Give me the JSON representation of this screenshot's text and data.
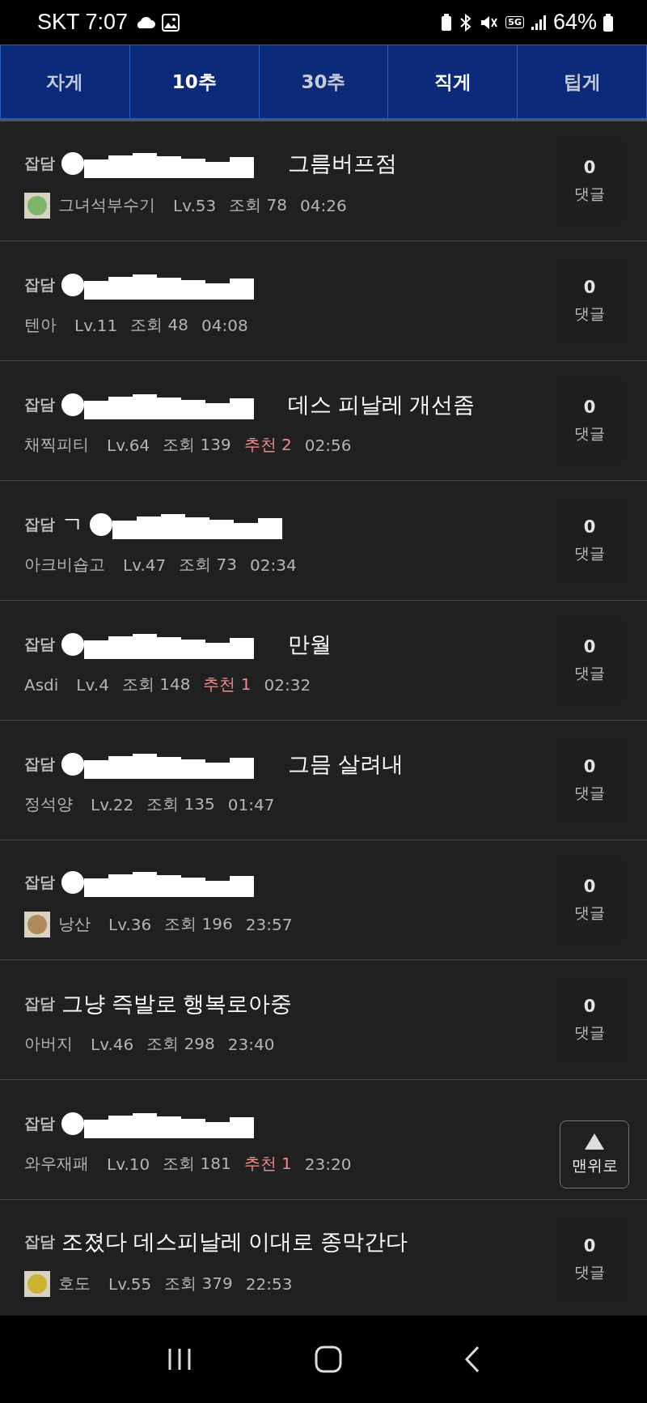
{
  "status_bar": {
    "carrier_time": "SKT 7:07",
    "network": "5G",
    "battery": "64%"
  },
  "tabs": [
    {
      "label": "자게",
      "selected": false
    },
    {
      "label": "10추",
      "selected": true
    },
    {
      "label": "30추",
      "selected": false
    },
    {
      "label": "직게",
      "selected": true
    },
    {
      "label": "팁게",
      "selected": false
    }
  ],
  "posts": [
    {
      "category": "잡담",
      "redacted": true,
      "title": "그름버프점",
      "avatar": {
        "color": "#7fb36a"
      },
      "author": "그녀석부수기",
      "level": "Lv.53",
      "views": "조회 78",
      "time": "04:26",
      "comments": "0",
      "comments_label": "댓글"
    },
    {
      "category": "잡담",
      "redacted": true,
      "author": "텐아",
      "level": "Lv.11",
      "views": "조회 48",
      "time": "04:08",
      "comments": "0",
      "comments_label": "댓글"
    },
    {
      "category": "잡담",
      "redacted": true,
      "title": "데스 피날레 개선좀",
      "author": "채찍피티",
      "level": "Lv.64",
      "views": "조회 139",
      "recommend": "추천 2",
      "time": "02:56",
      "comments": "0",
      "comments_label": "댓글"
    },
    {
      "category": "잡담",
      "prefix": "ㄱ",
      "redacted": true,
      "author": "아크비숍고",
      "level": "Lv.47",
      "views": "조회 73",
      "time": "02:34",
      "comments": "0",
      "comments_label": "댓글"
    },
    {
      "category": "잡담",
      "redacted": true,
      "title": "만월",
      "author": "Asdi",
      "level": "Lv.4",
      "views": "조회 148",
      "recommend": "추천 1",
      "time": "02:32",
      "comments": "0",
      "comments_label": "댓글"
    },
    {
      "category": "잡담",
      "redacted": true,
      "title": "그믐 살려내",
      "author": "정석양",
      "level": "Lv.22",
      "views": "조회 135",
      "time": "01:47",
      "comments": "0",
      "comments_label": "댓글"
    },
    {
      "category": "잡담",
      "redacted": true,
      "avatar": {
        "color": "#b08a5a"
      },
      "author": "낭산",
      "level": "Lv.36",
      "views": "조회 196",
      "time": "23:57",
      "comments": "0",
      "comments_label": "댓글"
    },
    {
      "category": "잡담",
      "redacted": false,
      "title": "그냥 즉발로 행복로아중",
      "author": "아버지",
      "level": "Lv.46",
      "views": "조회 298",
      "time": "23:40",
      "comments": "0",
      "comments_label": "댓글"
    },
    {
      "category": "잡담",
      "redacted": true,
      "author": "와우재패",
      "level": "Lv.10",
      "views": "조회 181",
      "recommend": "추천 1",
      "time": "23:20"
    },
    {
      "category": "잡담",
      "redacted": false,
      "title": "조졌다 데스피날레 이대로 종막간다",
      "avatar": {
        "color": "#c9b230"
      },
      "author": "호도",
      "level": "Lv.55",
      "views": "조회 379",
      "time": "22:53",
      "comments": "0",
      "comments_label": "댓글"
    }
  ],
  "top_button": {
    "label": "맨위로"
  }
}
